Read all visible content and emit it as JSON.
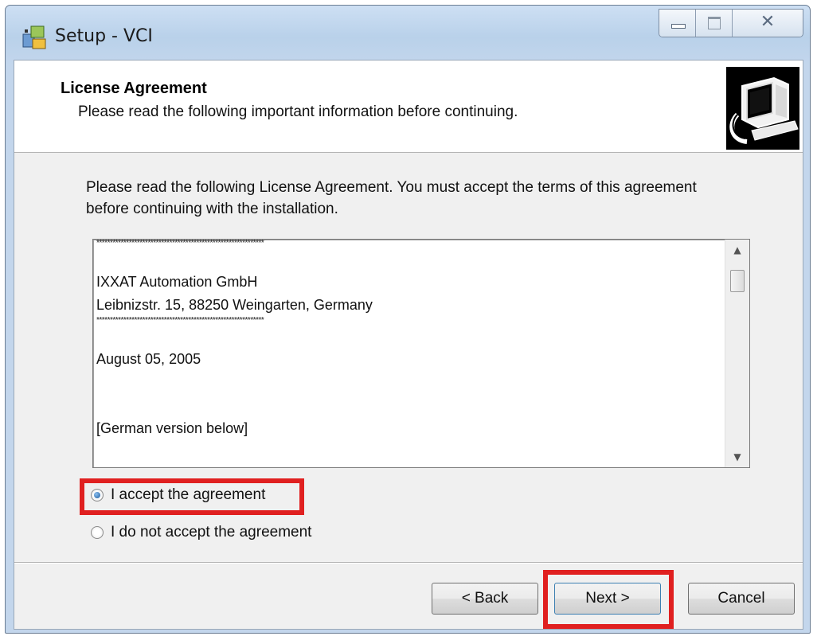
{
  "window": {
    "title": "Setup - VCI",
    "close_glyph": "✕",
    "icons": {
      "app": "setup-installer-icon",
      "minimize": "minimize-icon",
      "maximize": "maximize-icon",
      "close": "close-icon"
    }
  },
  "header": {
    "title": "License Agreement",
    "subtitle": "Please read the following important information before continuing.",
    "image_icon": "computer-install-icon"
  },
  "intro": "Please read the following License Agreement. You must accept the terms of this agreement before continuing with the installation.",
  "license": {
    "stars": "**************************************************************",
    "lines": [
      "",
      "IXXAT Automation GmbH",
      "Leibnizstr. 15, 88250 Weingarten, Germany",
      "",
      "August 05, 2005",
      "",
      "",
      "[German version below]"
    ],
    "scroll": {
      "up_glyph": "▲",
      "down_glyph": "▼",
      "thumb_position": 0.05
    }
  },
  "options": {
    "accept_label": "I accept the agreement",
    "decline_label": "I do not accept the agreement",
    "selected": "accept"
  },
  "buttons": {
    "back": "< Back",
    "next": "Next >",
    "cancel": "Cancel"
  },
  "colors": {
    "highlight": "#e02020",
    "title_bar": "#b9d1ea",
    "client_bg": "#f0f0f0"
  }
}
